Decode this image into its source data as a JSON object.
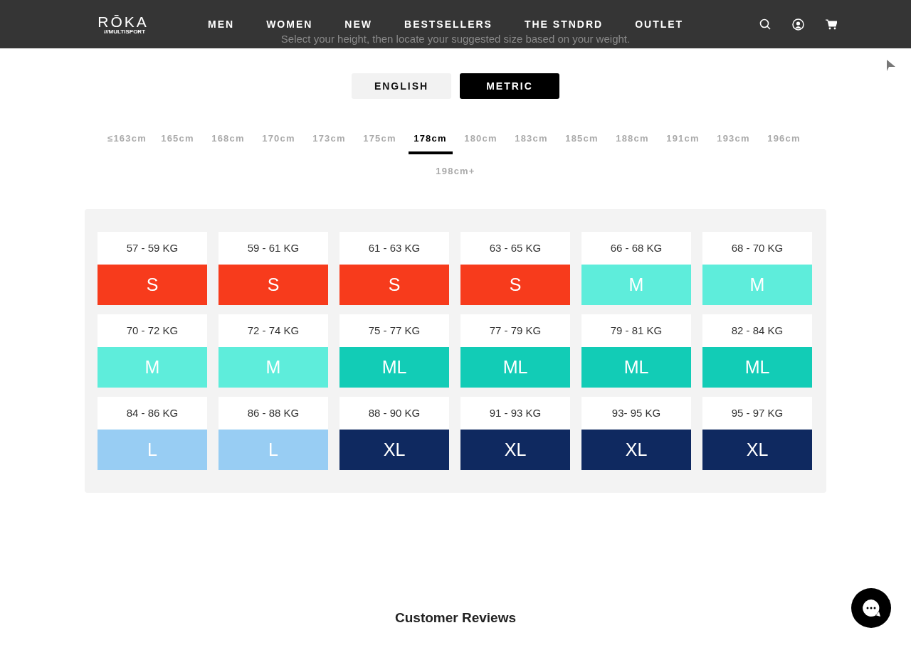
{
  "nav": {
    "logo": "RŌKA",
    "logo_sub": "///MULTISPORT",
    "links": [
      "MEN",
      "WOMEN",
      "NEW",
      "BESTSELLERS",
      "THE STNDRD",
      "OUTLET"
    ]
  },
  "hint": "Select your height, then locate your suggested size based on your weight.",
  "units": [
    {
      "label": "ENGLISH",
      "selected": false
    },
    {
      "label": "METRIC",
      "selected": true
    }
  ],
  "heights": [
    {
      "label": "≤163cm",
      "selected": false
    },
    {
      "label": "165cm",
      "selected": false
    },
    {
      "label": "168cm",
      "selected": false
    },
    {
      "label": "170cm",
      "selected": false
    },
    {
      "label": "173cm",
      "selected": false
    },
    {
      "label": "175cm",
      "selected": false
    },
    {
      "label": "178cm",
      "selected": true
    },
    {
      "label": "180cm",
      "selected": false
    },
    {
      "label": "183cm",
      "selected": false
    },
    {
      "label": "185cm",
      "selected": false
    },
    {
      "label": "188cm",
      "selected": false
    },
    {
      "label": "191cm",
      "selected": false
    },
    {
      "label": "193cm",
      "selected": false
    },
    {
      "label": "196cm",
      "selected": false
    },
    {
      "label": "198cm+",
      "selected": false
    }
  ],
  "sizes": [
    {
      "weight": "57 - 59 KG",
      "size": "S",
      "color": "#f73b1c"
    },
    {
      "weight": "59 - 61 KG",
      "size": "S",
      "color": "#f73b1c"
    },
    {
      "weight": "61 - 63 KG",
      "size": "S",
      "color": "#f73b1c"
    },
    {
      "weight": "63 - 65 KG",
      "size": "S",
      "color": "#f73b1c"
    },
    {
      "weight": "66 - 68 KG",
      "size": "M",
      "color": "#5eeddb"
    },
    {
      "weight": "68 - 70 KG",
      "size": "M",
      "color": "#5eeddb"
    },
    {
      "weight": "70 - 72 KG",
      "size": "M",
      "color": "#5eeddb"
    },
    {
      "weight": "72 - 74 KG",
      "size": "M",
      "color": "#5eeddb"
    },
    {
      "weight": "75 - 77 KG",
      "size": "ML",
      "color": "#12ccb6"
    },
    {
      "weight": "77 - 79 KG",
      "size": "ML",
      "color": "#12ccb6"
    },
    {
      "weight": "79 - 81 KG",
      "size": "ML",
      "color": "#12ccb6"
    },
    {
      "weight": "82 - 84 KG",
      "size": "ML",
      "color": "#12ccb6"
    },
    {
      "weight": "84 - 86 KG",
      "size": "L",
      "color": "#98cdf3"
    },
    {
      "weight": "86 - 88 KG",
      "size": "L",
      "color": "#98cdf3"
    },
    {
      "weight": "88 - 90 KG",
      "size": "XL",
      "color": "#0f2960"
    },
    {
      "weight": "91 - 93 KG",
      "size": "XL",
      "color": "#0f2960"
    },
    {
      "weight": "93- 95 KG",
      "size": "XL",
      "color": "#0f2960"
    },
    {
      "weight": "95 - 97 KG",
      "size": "XL",
      "color": "#0f2960"
    }
  ],
  "reviews_title": "Customer Reviews"
}
